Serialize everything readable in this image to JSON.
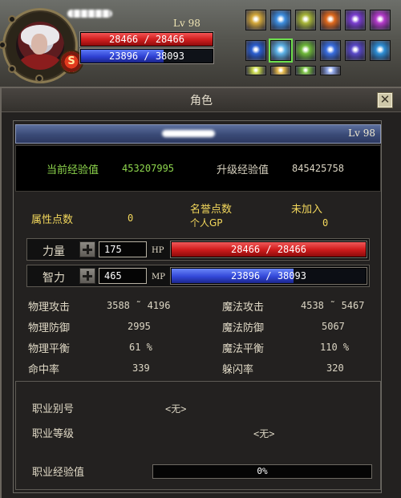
{
  "hud": {
    "level": "Lv 98",
    "hp_text": "28466 / 28466",
    "mp_text": "23896 / 38093",
    "mp_fraction": 0.627,
    "emblem": "S"
  },
  "skills": [
    {
      "icon": "scroll-skill-icon",
      "color": "#d4a93c"
    },
    {
      "icon": "ice-burst-skill-icon",
      "color": "#3f8fe0"
    },
    {
      "icon": "goblin-summon-skill-icon",
      "color": "#a8b63a"
    },
    {
      "icon": "fire-skill-icon",
      "color": "#e06a1e"
    },
    {
      "icon": "arcane-orb-skill-icon",
      "color": "#7b3fd0"
    },
    {
      "icon": "purple-pulse-skill-icon",
      "color": "#b33bc9"
    },
    {
      "icon": "water-wave-skill-icon",
      "color": "#2c5fcf"
    },
    {
      "icon": "frost-shield-skill-icon",
      "color": "#5fb4e8"
    },
    {
      "icon": "green-aura-skill-icon",
      "color": "#6fb83a"
    },
    {
      "icon": "blue-flare-skill-icon",
      "color": "#3a6fe0"
    },
    {
      "icon": "void-sphere-skill-icon",
      "color": "#5a4ac8"
    },
    {
      "icon": "storm-skill-icon",
      "color": "#2f8fd6"
    },
    {
      "icon": "lightning-skill-icon",
      "color": "#c9d94a"
    },
    {
      "icon": "sunburst-skill-icon",
      "color": "#e6b94a"
    },
    {
      "icon": "nature-skill-icon",
      "color": "#79c043"
    },
    {
      "icon": "ice-arc-skill-icon",
      "color": "#8fa6e8"
    }
  ],
  "window": {
    "title": "角色",
    "close": "✕"
  },
  "character": {
    "level": "Lv 98",
    "current_exp_label": "当前经验值",
    "current_exp": "453207995",
    "next_exp_label": "升级经验值",
    "next_exp": "845425758"
  },
  "attributes": {
    "points_label": "属性点数",
    "points": "0",
    "honor_label": "名誉点数",
    "honor_status": "未加入",
    "personal_gp_label": "个人GP",
    "personal_gp": "0",
    "str_label": "力量",
    "str": "175",
    "int_label": "智力",
    "int": "465",
    "hp_label": "HP",
    "hp_text": "28466 / 28466",
    "mp_label": "MP",
    "mp_text": "23896 / 38093",
    "mp_fraction": 0.627
  },
  "stats": {
    "phys_atk_label": "物理攻击",
    "phys_atk": "3588 ˜ 4196",
    "mag_atk_label": "魔法攻击",
    "mag_atk": "4538 ˜ 5467",
    "phys_def_label": "物理防御",
    "phys_def": "2995",
    "mag_def_label": "魔法防御",
    "mag_def": "5067",
    "phys_bal_label": "物理平衡",
    "phys_bal": "61 %",
    "mag_bal_label": "魔法平衡",
    "mag_bal": "110 %",
    "hit_label": "命中率",
    "hit": "339",
    "dodge_label": "躲闪率",
    "dodge": "320"
  },
  "job": {
    "alias_label": "职业别号",
    "alias": "<无>",
    "level_label": "职业等级",
    "level": "<无>",
    "exp_label": "职业经验值",
    "exp": "0%"
  }
}
